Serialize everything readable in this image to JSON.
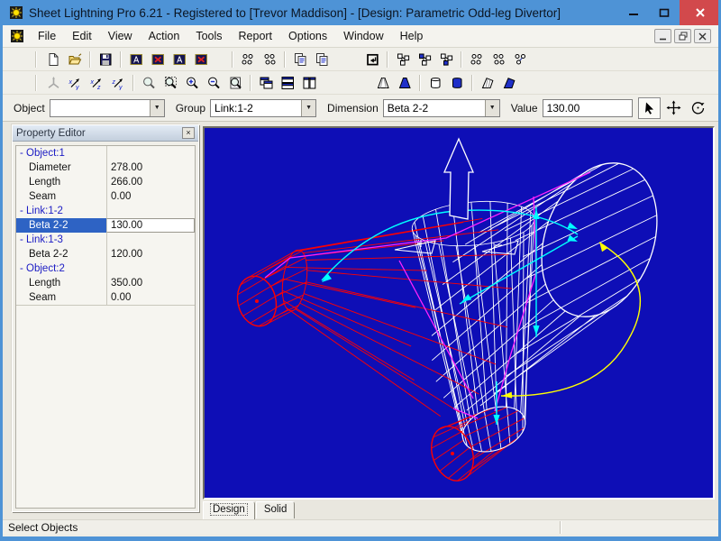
{
  "window": {
    "title": "Sheet Lightning Pro 6.21 - Registered to [Trevor Maddison] - [Design: Parametric Odd-leg Divertor]",
    "controls": [
      "minimize",
      "maximize",
      "close"
    ]
  },
  "menu": {
    "items": [
      "File",
      "Edit",
      "View",
      "Action",
      "Tools",
      "Report",
      "Options",
      "Window",
      "Help"
    ],
    "mdi_controls": [
      "minimize",
      "restore",
      "close"
    ]
  },
  "toolbars": {
    "row1": [
      {
        "name": "new-document-button",
        "glyph": "newdoc"
      },
      {
        "name": "open-file-button",
        "glyph": "open"
      },
      {
        "name": "save-button",
        "glyph": "save",
        "sep": true
      },
      {
        "name": "open-2d-cad-button",
        "glyph": "cadwin",
        "sep": true
      },
      {
        "name": "close-2d-cad-button",
        "glyph": "cadclose"
      },
      {
        "name": "open-3d-cad-button",
        "glyph": "cadwin"
      },
      {
        "name": "close-3d-cad-button",
        "glyph": "cadclose"
      },
      {
        "name": "unfold-selected-button",
        "glyph": "dots4",
        "sep": true,
        "gap": 18
      },
      {
        "name": "unfold-all-button",
        "glyph": "dots4b"
      },
      {
        "name": "copy-button",
        "glyph": "copy",
        "sep": true
      },
      {
        "name": "copy-drawing-button",
        "glyph": "copy"
      },
      {
        "name": "insert-object-button",
        "glyph": "insbox",
        "gap": 32
      },
      {
        "name": "link-tree-button",
        "glyph": "tree0",
        "sep": true
      },
      {
        "name": "link-parent-button",
        "glyph": "tree1"
      },
      {
        "name": "link-child-button",
        "glyph": "tree2"
      },
      {
        "name": "group-points-button",
        "glyph": "dots4",
        "sep": true
      },
      {
        "name": "ungroup-points-button",
        "glyph": "dots4b"
      },
      {
        "name": "link-points-button",
        "glyph": "dots3"
      }
    ],
    "row2": [
      {
        "name": "axes-button",
        "glyph": "axes",
        "disabled": true
      },
      {
        "name": "view-xy-button",
        "glyph": "view",
        "letters": [
          "x",
          "y"
        ]
      },
      {
        "name": "view-xz-button",
        "glyph": "view",
        "letters": [
          "x",
          "z"
        ]
      },
      {
        "name": "view-zy-button",
        "glyph": "view",
        "letters": [
          "z",
          "y"
        ]
      },
      {
        "name": "zoom-tool-button",
        "glyph": "zoom",
        "sep": true
      },
      {
        "name": "zoom-window-button",
        "glyph": "zoomwin"
      },
      {
        "name": "zoom-in-button",
        "glyph": "zoomin"
      },
      {
        "name": "zoom-out-button",
        "glyph": "zoomout"
      },
      {
        "name": "zoom-extents-button",
        "glyph": "zoomall"
      },
      {
        "name": "cascade-windows-button",
        "glyph": "cascade",
        "sep": true
      },
      {
        "name": "tile-horizontal-button",
        "glyph": "tileh"
      },
      {
        "name": "tile-vertical-button",
        "glyph": "tilev"
      },
      {
        "name": "wireframe-cone-button",
        "glyph": "coneo",
        "gap": 58
      },
      {
        "name": "solid-cone-button",
        "glyph": "coneb"
      },
      {
        "name": "wireframe-cylinder-button",
        "glyph": "cylo",
        "sep": true
      },
      {
        "name": "solid-cylinder-button",
        "glyph": "cylb"
      },
      {
        "name": "flat-pattern-button",
        "glyph": "flato",
        "sep": true
      },
      {
        "name": "solid-flat-pattern-button",
        "glyph": "flatb"
      }
    ]
  },
  "param_bar": {
    "object_label": "Object",
    "object_value": "",
    "group_label": "Group",
    "group_value": "Link:1-2",
    "dimension_label": "Dimension",
    "dimension_value": "Beta 2-2",
    "value_label": "Value",
    "value_value": "130.00",
    "tools": [
      "select-tool",
      "pan-tool",
      "rotate-tool"
    ]
  },
  "property_editor": {
    "title": "Property Editor",
    "rows": [
      {
        "group": "- Object:1"
      },
      {
        "name": "Diameter",
        "value": "278.00"
      },
      {
        "name": "Length",
        "value": "266.00"
      },
      {
        "name": "Seam",
        "value": "0.00"
      },
      {
        "group": "- Link:1-2"
      },
      {
        "name": "Beta 2-2",
        "value": "130.00",
        "selected": true
      },
      {
        "group": "- Link:1-3"
      },
      {
        "name": "Beta 2-2",
        "value": "120.00"
      },
      {
        "group": "- Object:2"
      },
      {
        "name": "Length",
        "value": "350.00"
      },
      {
        "name": "Seam",
        "value": "0.00"
      }
    ]
  },
  "viewport": {
    "tabs": [
      {
        "label": "Design",
        "active": true
      },
      {
        "label": "Solid",
        "active": false
      }
    ],
    "background": "#0e0eb6",
    "wire_colors": {
      "main": "#ffffff",
      "branch": "#ff0000",
      "seam": "#ff22ff",
      "dimension": "#00ffff",
      "dimension_alt": "#ffff00"
    }
  },
  "status_bar": {
    "text": "Select Objects"
  },
  "theme": {
    "titlebar": "#4e93d6",
    "close_button": "#d2494c",
    "selection": "#2e63c4",
    "chrome": "#f0efe9"
  }
}
